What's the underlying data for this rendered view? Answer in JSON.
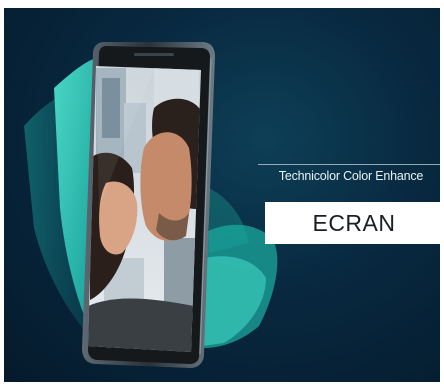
{
  "promo": {
    "tagline": "Technicolor Color Enhance",
    "label": "ECRAN"
  },
  "colors": {
    "background_dark": "#051a2c",
    "accent_teal": "#2bc4b4",
    "badge_background": "#ffffff"
  }
}
